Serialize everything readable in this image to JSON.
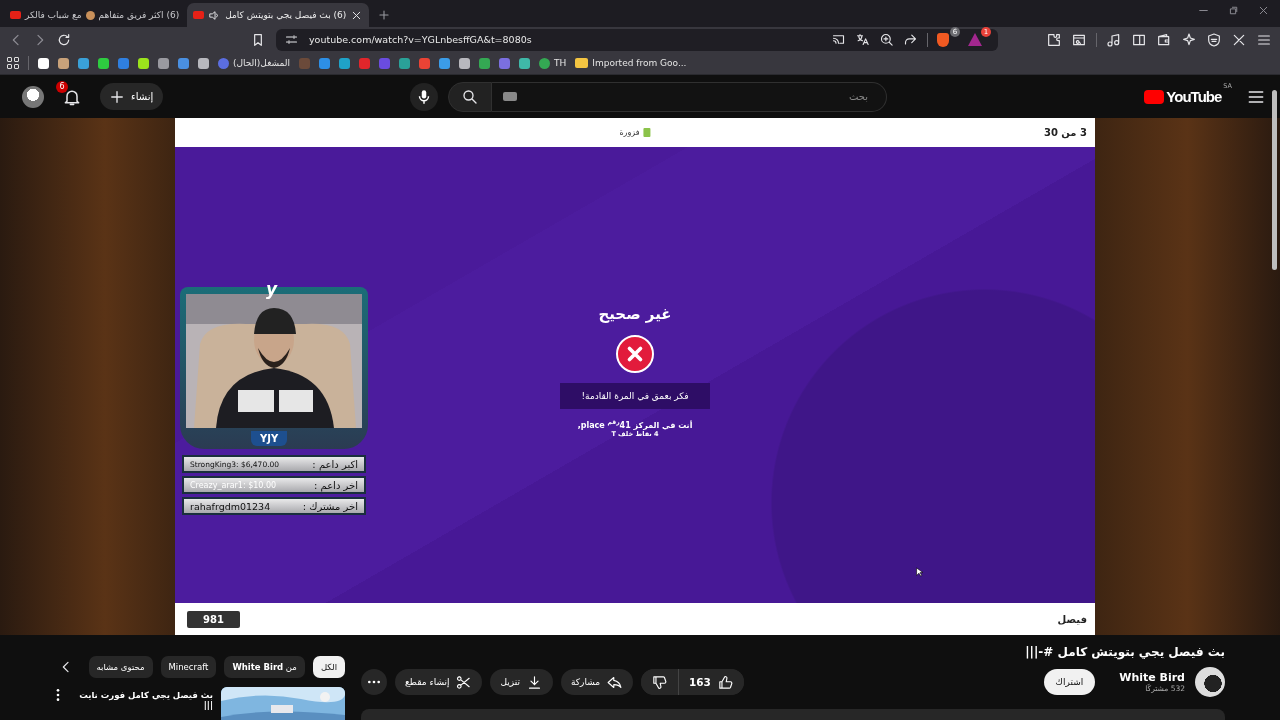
{
  "browser": {
    "tabs": [
      {
        "title_parts": [
          "(6) بث فيصل يجي بتويتش كامل"
        ],
        "selected": true,
        "audio": true
      },
      {
        "title_parts": [
          "(6) اكثر فريق متفاهم",
          "مع شباب فالكر"
        ],
        "selected": false,
        "audio": false
      }
    ],
    "address": "youtube.com/watch?v=YGLnbesffGA&t=8080s",
    "shield_badge": "6",
    "rewards_badge": "1",
    "bookmarks": [
      {
        "kind": "folder",
        "color": "#f4c542",
        "label": "Imported from Goo..."
      },
      {
        "kind": "site",
        "color": "#34a853",
        "label": "TH"
      },
      {
        "kind": "icon",
        "color": "#3fb8a8"
      },
      {
        "kind": "icon",
        "color": "#7b6fe0"
      },
      {
        "kind": "icon",
        "color": "#34a853"
      },
      {
        "kind": "icon",
        "color": "#b8b8be"
      },
      {
        "kind": "icon",
        "color": "#3b9ce8"
      },
      {
        "kind": "icon",
        "color": "#ea4335"
      },
      {
        "kind": "icon",
        "color": "#2aa198"
      },
      {
        "kind": "icon",
        "color": "#6a4ce0"
      },
      {
        "kind": "icon",
        "color": "#e0262b"
      },
      {
        "kind": "icon",
        "color": "#1fa2c8"
      },
      {
        "kind": "icon",
        "color": "#2d8fe6"
      },
      {
        "kind": "icon",
        "color": "#6b4a3a"
      },
      {
        "kind": "site",
        "color": "#5b6ee1",
        "label": "المشغل(الحال)"
      },
      {
        "kind": "icon",
        "color": "#b8b8be"
      },
      {
        "kind": "icon",
        "color": "#4a90e2"
      },
      {
        "kind": "icon",
        "color": "#9a9aa0"
      },
      {
        "kind": "icon",
        "color": "#9be31c"
      },
      {
        "kind": "icon",
        "color": "#2f7fe0"
      },
      {
        "kind": "icon",
        "color": "#2ecc40"
      },
      {
        "kind": "icon",
        "color": "#3aa0d8"
      },
      {
        "kind": "icon",
        "color": "#c9a27a"
      },
      {
        "kind": "icon",
        "color": "#ffffff"
      }
    ]
  },
  "header": {
    "logo": "YouTube",
    "region": "SA",
    "search_placeholder": "بحث",
    "create": "إنشاء",
    "notifications": "6"
  },
  "video": {
    "counter": "3 من 30",
    "question_type": "فزورة",
    "result": "غير صحيح",
    "correct": false,
    "message": "فكر بعمق في المرة القادمة!",
    "rank_line": "أنت في المركز 41$^{رقم}$ place,",
    "behind_line": "4 نقاط خلف T",
    "player": "فيصل",
    "score": "981",
    "overlay": {
      "logo": "y",
      "banner": "YJY",
      "rows": [
        {
          "label": "اكبر داعم :",
          "value": "StrongKing3: $6,470.00"
        },
        {
          "label": "اخر داعم :",
          "value": "Creazy_arar1: $10.00"
        },
        {
          "label": "اخر مشترك :",
          "value": "rahafrgdm01234"
        }
      ]
    }
  },
  "details": {
    "title": "بث فيصل يجي بتويتش كامل #-|||",
    "channel": "White Bird",
    "subscribers": "532 مشتركًا",
    "subscribe": "اشتراك",
    "likes": "163",
    "actions": [
      {
        "kind": "share",
        "label": "مشاركة"
      },
      {
        "kind": "download",
        "label": "تنزيل"
      },
      {
        "kind": "clip",
        "label": "إنشاء مقطع"
      }
    ]
  },
  "related": {
    "chips": [
      {
        "label": "الكل",
        "selected": true
      },
      {
        "label": "من **White Bird**",
        "selected": false
      },
      {
        "label": "Minecraft",
        "selected": false
      },
      {
        "label": "محتوى مشابه",
        "selected": false
      }
    ],
    "videos": [
      {
        "title": "بث فيصل يجي كامل فورت نايت |||"
      }
    ]
  }
}
